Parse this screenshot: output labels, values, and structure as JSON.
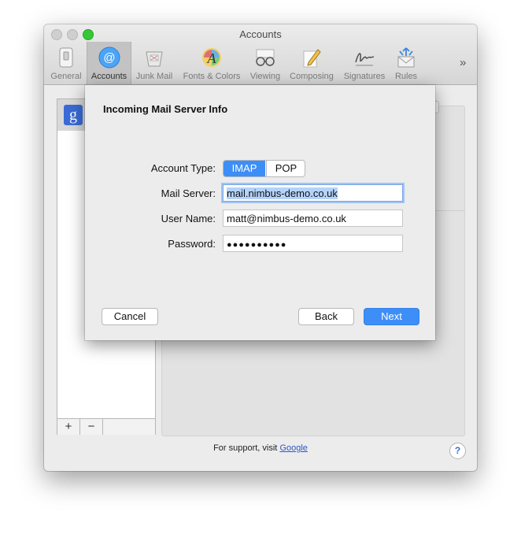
{
  "window": {
    "title": "Accounts"
  },
  "toolbar": {
    "items": [
      {
        "label": "General"
      },
      {
        "label": "Accounts"
      },
      {
        "label": "Junk Mail"
      },
      {
        "label": "Fonts & Colors"
      },
      {
        "label": "Viewing"
      },
      {
        "label": "Composing"
      },
      {
        "label": "Signatures"
      },
      {
        "label": "Rules"
      }
    ],
    "selected": "Accounts",
    "more_label": "»"
  },
  "accounts": {
    "items": [
      {
        "icon_letter": "g"
      }
    ],
    "add_label": "+",
    "remove_label": "−"
  },
  "footer": {
    "support_prefix": "For support, visit",
    "support_link": "Google",
    "help_label": "?"
  },
  "sheet": {
    "title": "Incoming Mail Server Info",
    "account_type_label": "Account Type:",
    "account_type_options": [
      "IMAP",
      "POP"
    ],
    "account_type_selected": "IMAP",
    "mail_server_label": "Mail Server:",
    "mail_server_value": "mail.nimbus-demo.co.uk",
    "user_name_label": "User Name:",
    "user_name_value": "matt@nimbus-demo.co.uk",
    "password_label": "Password:",
    "password_value": "●●●●●●●●●●",
    "cancel_label": "Cancel",
    "back_label": "Back",
    "next_label": "Next"
  }
}
